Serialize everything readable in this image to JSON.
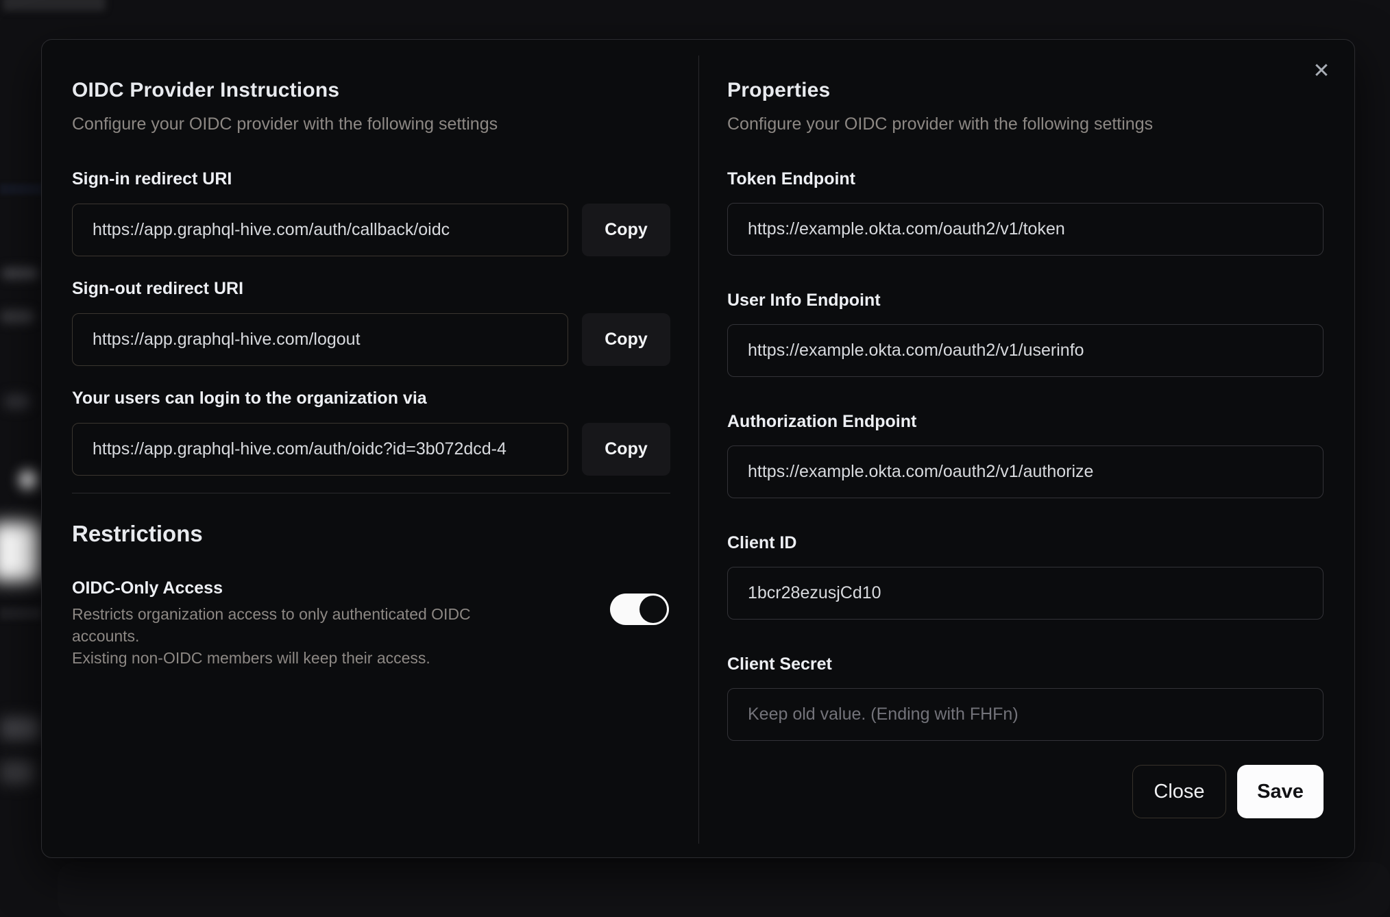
{
  "colors": {
    "page_bg": "#101013",
    "modal_bg": "#0b0c0e",
    "save_bg": "#fcfcfd",
    "toggle_on": "#fafafa"
  },
  "modal": {
    "close_icon": "✕",
    "left": {
      "title": "OIDC Provider Instructions",
      "subtitle": "Configure your OIDC provider with the following settings",
      "fields": [
        {
          "label": "Sign-in redirect URI",
          "value": "https://app.graphql-hive.com/auth/callback/oidc",
          "copy_label": "Copy"
        },
        {
          "label": "Sign-out redirect URI",
          "value": "https://app.graphql-hive.com/logout",
          "copy_label": "Copy"
        },
        {
          "label": "Your users can login to the organization via",
          "value": "https://app.graphql-hive.com/auth/oidc?id=3b072dcd-4",
          "copy_label": "Copy"
        }
      ],
      "restrictions": {
        "title": "Restrictions",
        "toggle_label": "OIDC-Only Access",
        "toggle_description_line1": "Restricts organization access to only authenticated OIDC accounts.",
        "toggle_description_line2": "Existing non-OIDC members will keep their access.",
        "toggle_state": "on"
      }
    },
    "right": {
      "title": "Properties",
      "subtitle": "Configure your OIDC provider with the following settings",
      "fields": [
        {
          "label": "Token Endpoint",
          "value": "https://example.okta.com/oauth2/v1/token"
        },
        {
          "label": "User Info Endpoint",
          "value": "https://example.okta.com/oauth2/v1/userinfo"
        },
        {
          "label": "Authorization Endpoint",
          "value": "https://example.okta.com/oauth2/v1/authorize"
        },
        {
          "label": "Client ID",
          "value": "1bcr28ezusjCd10"
        },
        {
          "label": "Client Secret",
          "value": "",
          "placeholder": "Keep old value. (Ending with FHFn)"
        }
      ],
      "buttons": {
        "close": "Close",
        "save": "Save"
      }
    }
  }
}
